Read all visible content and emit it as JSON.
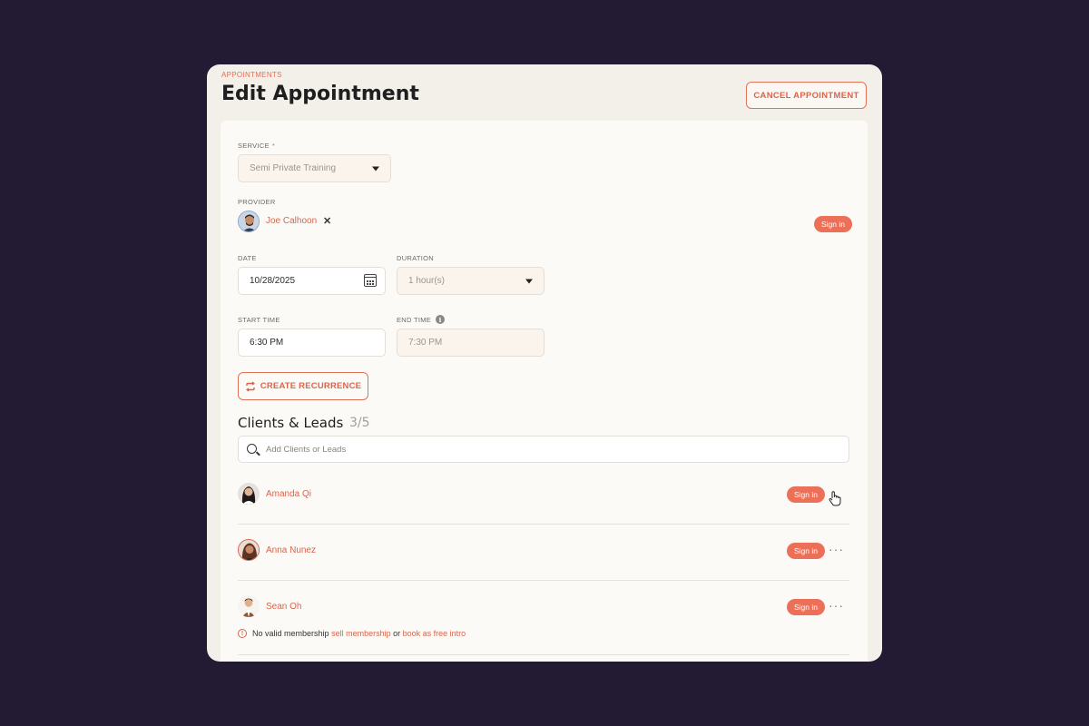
{
  "header": {
    "breadcrumb": "APPOINTMENTS",
    "title": "Edit Appointment",
    "cancel_label": "CANCEL APPOINTMENT"
  },
  "form": {
    "service": {
      "label": "SERVICE",
      "required_mark": "*",
      "value": "Semi Private Training"
    },
    "provider": {
      "label": "PROVIDER",
      "name": "Joe Calhoon",
      "remove_glyph": "✕",
      "sign_in_label": "Sign in"
    },
    "date": {
      "label": "DATE",
      "value": "10/28/2025"
    },
    "duration": {
      "label": "DURATION",
      "value": "1 hour(s)"
    },
    "start_time": {
      "label": "START TIME",
      "value": "6:30 PM"
    },
    "end_time": {
      "label": "END TIME",
      "value": "7:30 PM",
      "info_glyph": "i"
    },
    "recurrence_label": "CREATE RECURRENCE"
  },
  "clients": {
    "title": "Clients & Leads",
    "count": "3/5",
    "search_placeholder": "Add Clients or Leads",
    "items": [
      {
        "name": "Amanda Qi",
        "sign_in_label": "Sign in"
      },
      {
        "name": "Anna Nunez",
        "sign_in_label": "Sign in",
        "more_glyph": "···"
      },
      {
        "name": "Sean Oh",
        "sign_in_label": "Sign in",
        "more_glyph": "···"
      }
    ],
    "warning": {
      "icon_glyph": "!",
      "text": "No valid membership",
      "link1": "sell membership",
      "joiner": "or",
      "link2": "book as free intro"
    }
  },
  "colors": {
    "accent": "#e0725a",
    "sign_in_bg": "#ec6f57",
    "backdrop": "#231a33"
  }
}
